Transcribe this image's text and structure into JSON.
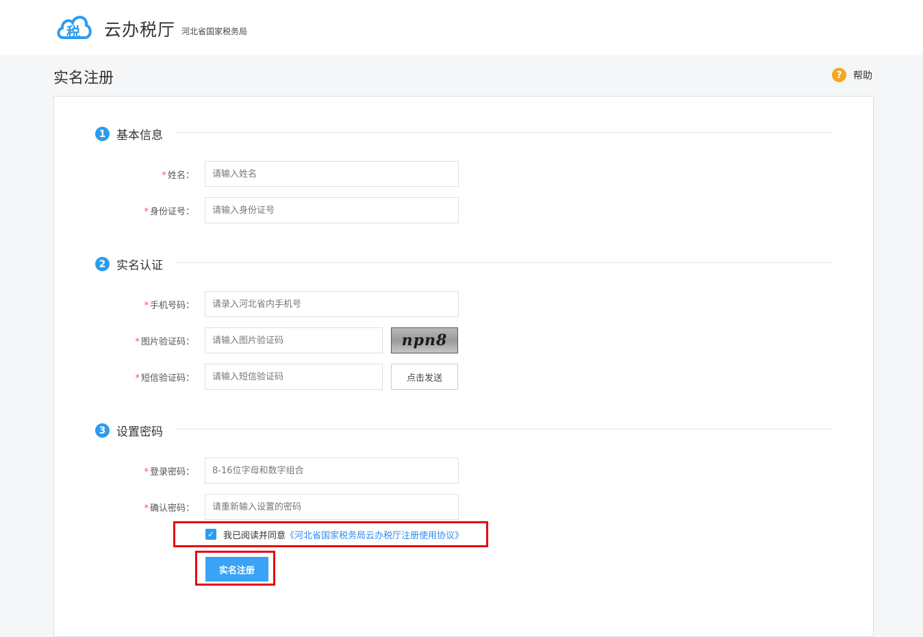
{
  "header": {
    "brand_title": "云办税厅",
    "brand_subtitle": "河北省国家税务局",
    "logo_glyph": "税",
    "logo_icon": "cloud-tax-logo-icon"
  },
  "page": {
    "title": "实名注册",
    "help_label": "帮助",
    "help_icon": "question-circle-icon"
  },
  "sections": [
    {
      "num": "1",
      "title": "基本信息"
    },
    {
      "num": "2",
      "title": "实名认证"
    },
    {
      "num": "3",
      "title": "设置密码"
    }
  ],
  "form": {
    "required_mark": "*",
    "name": {
      "label": "姓名：",
      "placeholder": "请输入姓名"
    },
    "id_number": {
      "label": "身份证号：",
      "placeholder": "请输入身份证号"
    },
    "phone": {
      "label": "手机号码：",
      "placeholder": "请录入河北省内手机号"
    },
    "image_code": {
      "label": "图片验证码：",
      "placeholder": "请输入图片验证码",
      "captcha_text": "npn8"
    },
    "sms_code": {
      "label": "短信验证码：",
      "placeholder": "请输入短信验证码",
      "send_button": "点击发送"
    },
    "password": {
      "label": "登录密码：",
      "placeholder": "8-16位字母和数字组合"
    },
    "confirm_password": {
      "label": "确认密码：",
      "placeholder": "请重新输入设置的密码"
    }
  },
  "agreement": {
    "checked": true,
    "check_glyph": "✓",
    "text": "我已阅读并同意",
    "link": "《河北省国家税务局云办税厅注册使用协议》"
  },
  "submit_label": "实名注册",
  "colors": {
    "accent": "#2d9bf0",
    "button": "#3aa3f5",
    "highlight_border": "#e60012",
    "help": "#f5a623",
    "required": "#ff4d4f"
  }
}
